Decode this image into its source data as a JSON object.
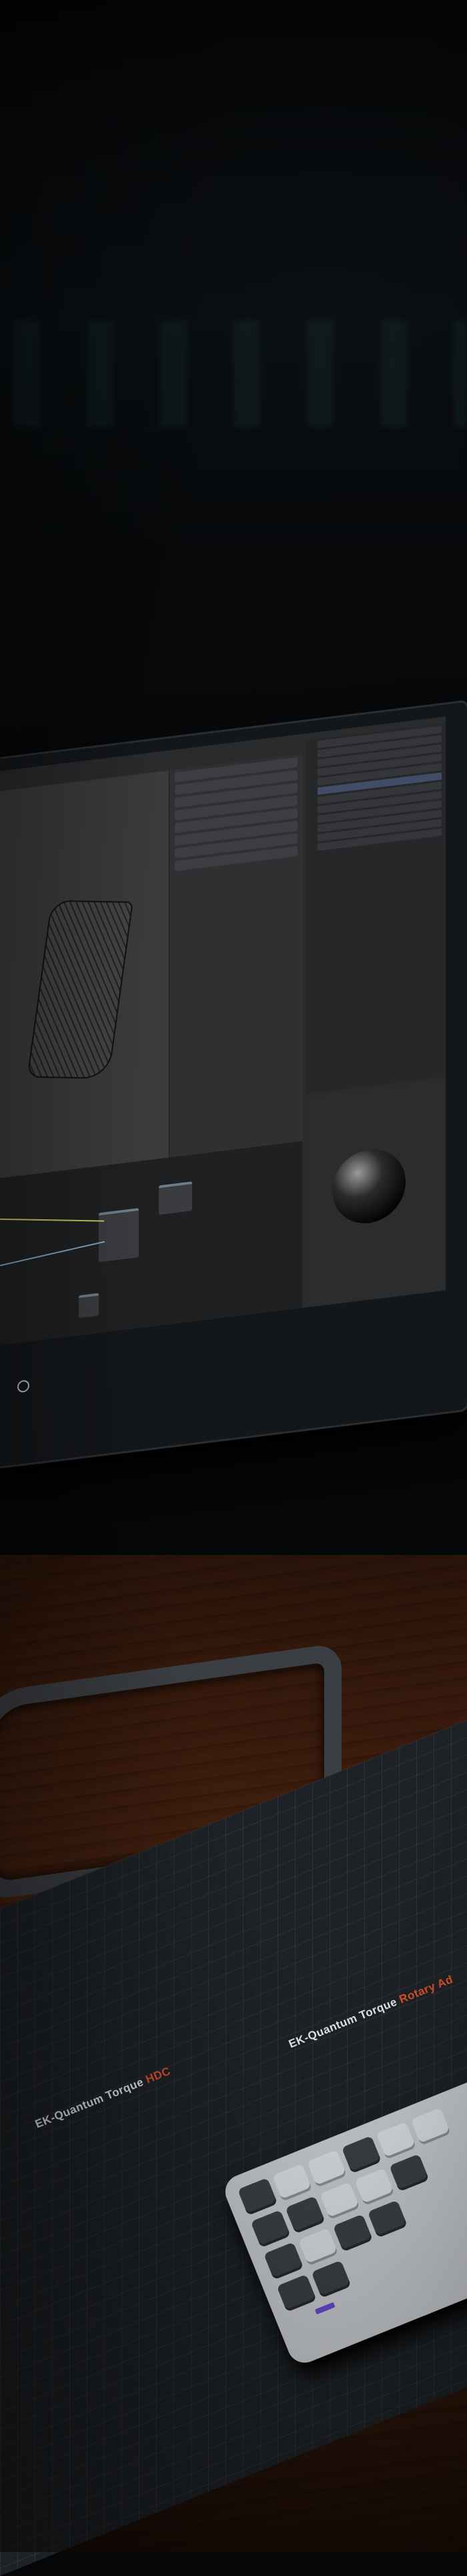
{
  "scene": {
    "colors": {
      "wall": "#050607",
      "desk_wood": "#3b1c0d",
      "monitor_bezel": "#14171a",
      "mat": "#1e2226",
      "accent_orange": "#e0502a",
      "keyboard_purple": "#6a48d6"
    },
    "mat_labels": [
      {
        "prefix": "EK-Quantum Torque ",
        "accent": "HDC"
      },
      {
        "prefix": "EK-Quantum Torque ",
        "accent": "Rotary Ad"
      }
    ]
  }
}
